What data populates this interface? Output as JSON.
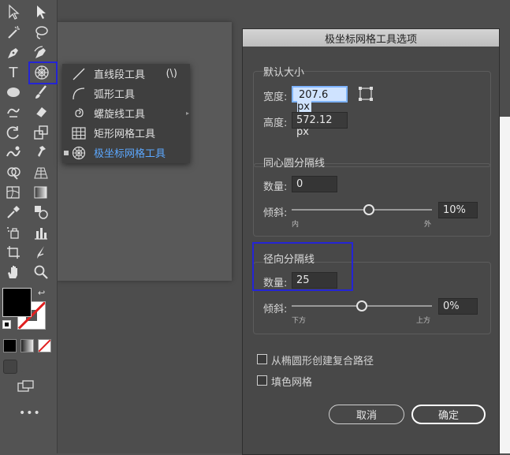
{
  "toolbar": {
    "tools": [
      {
        "name": "selection-tool-icon"
      },
      {
        "name": "direct-selection-tool-icon"
      },
      {
        "name": "magic-wand-tool-icon"
      },
      {
        "name": "lasso-tool-icon"
      },
      {
        "name": "pen-tool-icon"
      },
      {
        "name": "curvature-tool-icon"
      },
      {
        "name": "type-tool-icon",
        "glyph": "T"
      },
      {
        "name": "polar-grid-tool-icon"
      },
      {
        "name": "ellipse-tool-icon"
      },
      {
        "name": "paintbrush-tool-icon"
      },
      {
        "name": "shaper-tool-icon"
      },
      {
        "name": "eraser-tool-icon"
      },
      {
        "name": "rotate-tool-icon"
      },
      {
        "name": "scale-tool-icon"
      },
      {
        "name": "warp-tool-icon"
      },
      {
        "name": "puppet-warp-tool-icon"
      },
      {
        "name": "shape-builder-tool-icon"
      },
      {
        "name": "perspective-grid-tool-icon"
      },
      {
        "name": "mesh-tool-icon"
      },
      {
        "name": "gradient-tool-icon"
      },
      {
        "name": "eyedropper-tool-icon"
      },
      {
        "name": "blend-tool-icon"
      },
      {
        "name": "symbol-sprayer-tool-icon"
      },
      {
        "name": "column-graph-tool-icon"
      },
      {
        "name": "artboard-tool-icon"
      },
      {
        "name": "slice-tool-icon"
      },
      {
        "name": "hand-tool-icon"
      },
      {
        "name": "zoom-tool-icon"
      }
    ],
    "more_label": "•••"
  },
  "flyout": {
    "items": [
      {
        "icon": "line-segment-icon",
        "label": "直线段工具",
        "key": "(\\)"
      },
      {
        "icon": "arc-icon",
        "label": "弧形工具",
        "key": ""
      },
      {
        "icon": "spiral-icon",
        "label": "螺旋线工具",
        "key": ""
      },
      {
        "icon": "rectangular-grid-icon",
        "label": "矩形网格工具",
        "key": ""
      },
      {
        "icon": "polar-grid-icon",
        "label": "极坐标网格工具",
        "key": "",
        "active": true
      }
    ]
  },
  "dialog": {
    "title": "极坐标网格工具选项",
    "default_size": {
      "title": "默认大小",
      "width_label": "宽度:",
      "width_value": "207.6 px",
      "height_label": "高度:",
      "height_value": "572.12 px"
    },
    "concentric": {
      "title": "同心圆分隔线",
      "count_label": "数量:",
      "count_value": "0",
      "skew_label": "倾斜:",
      "skew_value": "10%",
      "skew_position": 0.55,
      "left_tag": "内",
      "right_tag": "外"
    },
    "radial": {
      "title": "径向分隔线",
      "count_label": "数量:",
      "count_value": "25",
      "skew_label": "倾斜:",
      "skew_value": "0%",
      "skew_position": 0.5,
      "left_tag": "下方",
      "right_tag": "上方"
    },
    "options": {
      "compound_path_label": "从椭圆形创建复合路径",
      "compound_path_checked": false,
      "fill_grid_label": "填色网格",
      "fill_grid_checked": false
    },
    "cancel_label": "取消",
    "ok_label": "确定"
  },
  "colors": {
    "highlight_box": "#2424d6",
    "active_menu_text": "#5ca8ff",
    "fill_swatch": "#000000",
    "stroke_swatch": "#ffffff",
    "none_slash": "#e02020"
  }
}
